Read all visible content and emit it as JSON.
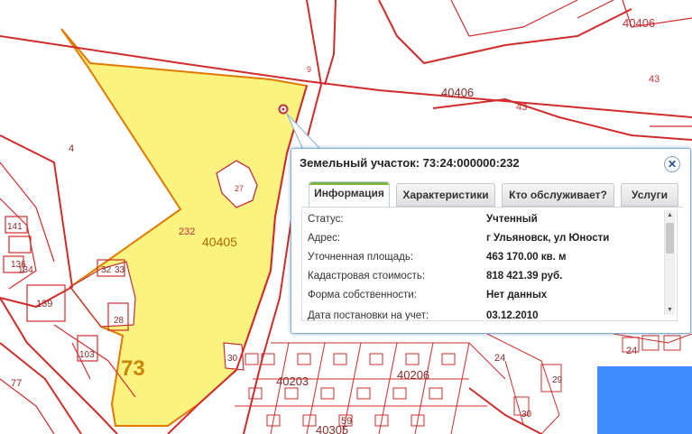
{
  "map": {
    "parcel_numbers": {
      "p40406_top": "40406",
      "p40406_mid": "40406",
      "p43_a": "43",
      "p43_b": "43",
      "p4": "4",
      "p232": "232",
      "p40405": "40405",
      "p27": "27",
      "p141": "141",
      "p136": "136",
      "p134": "134",
      "p139": "139",
      "p32": "32",
      "p33": "33",
      "p28": "28",
      "p103": "103",
      "p77": "77",
      "p30": "30",
      "p40203": "40203",
      "p40206": "40206",
      "p40305": "40305",
      "p59": "59",
      "p24_a": "24",
      "p24_b": "24",
      "p29": "29",
      "p30b": "30",
      "p9": "9"
    },
    "region_label": "73",
    "colors": {
      "parcel_fill": "#fbf37f",
      "parcel_border": "#e07a00",
      "cadastral_line": "#d22b2b",
      "label": "#c0303a"
    }
  },
  "popup": {
    "title": "Земельный участок: 73:24:000000:232",
    "close_icon": "close-icon",
    "tabs": [
      {
        "label": "Информация",
        "active": true
      },
      {
        "label": "Характеристики",
        "active": false
      },
      {
        "label": "Кто обслуживает?",
        "active": false
      },
      {
        "label": "Услуги",
        "active": false
      }
    ],
    "rows": [
      {
        "label": "Статус:",
        "value": "Учтенный"
      },
      {
        "label": "Адрес:",
        "value": "г Ульяновск, ул Юности"
      },
      {
        "label": "Уточненная площадь:",
        "value": "463 170.00 кв. м"
      },
      {
        "label": "Кадастровая стоимость:",
        "value": "818 421.39 руб."
      },
      {
        "label": "Форма собственности:",
        "value": "Нет данных"
      },
      {
        "label": "Дата постановки на учет:",
        "value": "03.12.2010"
      }
    ]
  }
}
